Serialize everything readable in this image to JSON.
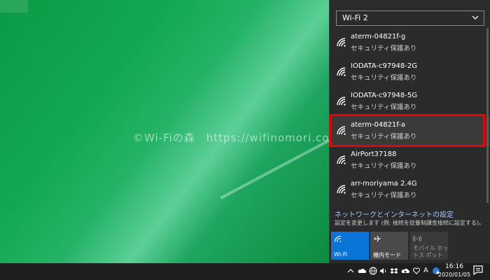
{
  "desktop": {
    "watermark": "©Wi-Fiの森　https://wifinomori.com"
  },
  "network_panel": {
    "adapter_selector": {
      "selected": "Wi-Fi 2"
    },
    "networks": [
      {
        "name": "aterm-04821f-g",
        "security": "セキュリティ保護あり"
      },
      {
        "name": "IODATA-c97948-2G",
        "security": "セキュリティ保護あり"
      },
      {
        "name": "IODATA-c97948-5G",
        "security": "セキュリティ保護あり"
      },
      {
        "name": "aterm-04821f-a",
        "security": "セキュリティ保護あり"
      },
      {
        "name": "AirPort37188",
        "security": "セキュリティ保護あり"
      },
      {
        "name": "arr-moriyama 2.4G",
        "security": "セキュリティ保護あり"
      }
    ],
    "settings_link": "ネットワークとインターネットの設定",
    "settings_desc": "設定を変更します (例: 接続を従量制課金接続に設定する)。",
    "tiles": {
      "wifi": "Wi-Fi",
      "airplane": "機内モード",
      "hotspot": "モバイル ホットス ポット"
    }
  },
  "taskbar": {
    "ime_label": "A",
    "clock_time": "16:16",
    "clock_date": "2020/01/05"
  },
  "colors": {
    "accent": "#0a74d8",
    "highlight": "#ee0000",
    "panel_bg": "#2b2b2b"
  }
}
